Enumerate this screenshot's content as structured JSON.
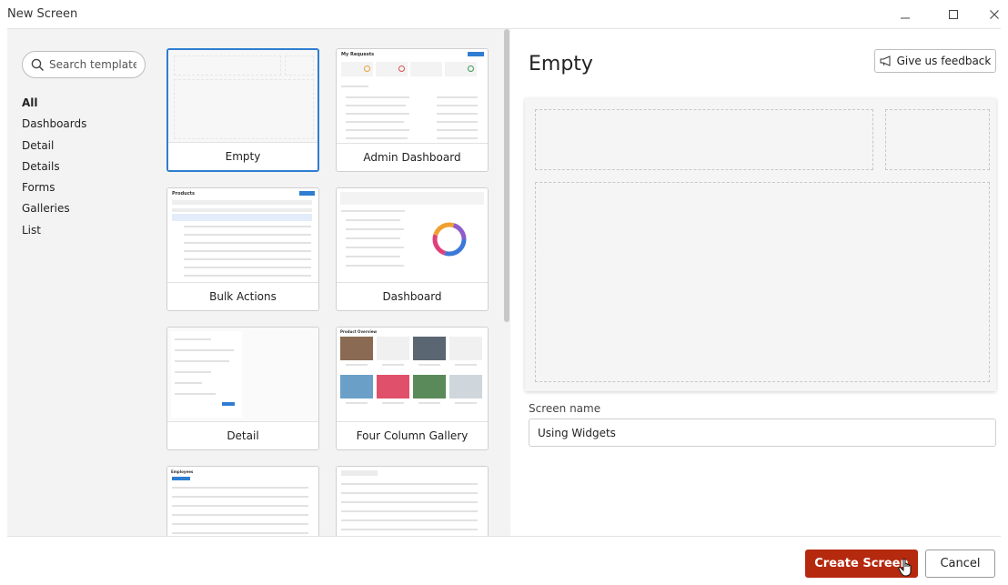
{
  "window": {
    "title": "New Screen"
  },
  "search": {
    "placeholder": "Search template"
  },
  "categories": [
    {
      "label": "All",
      "active": true
    },
    {
      "label": "Dashboards"
    },
    {
      "label": "Detail"
    },
    {
      "label": "Details"
    },
    {
      "label": "Forms"
    },
    {
      "label": "Galleries"
    },
    {
      "label": "List"
    }
  ],
  "templates": [
    {
      "label": "Empty",
      "selected": true
    },
    {
      "label": "Admin Dashboard"
    },
    {
      "label": "Bulk Actions"
    },
    {
      "label": "Dashboard"
    },
    {
      "label": "Detail"
    },
    {
      "label": "Four Column Gallery"
    }
  ],
  "thumbs": {
    "admin_title": "My Requests",
    "products_title": "Products",
    "product_overview_title": "Product Overview",
    "employees_title": "Employees"
  },
  "preview": {
    "title": "Empty",
    "feedback_label": "Give us feedback"
  },
  "screen_name": {
    "label": "Screen name",
    "value": "Using Widgets"
  },
  "footer": {
    "create_label": "Create Screen",
    "cancel_label": "Cancel"
  },
  "colors": {
    "primary": "#b5290f",
    "selected_border": "#2f7dd1"
  }
}
